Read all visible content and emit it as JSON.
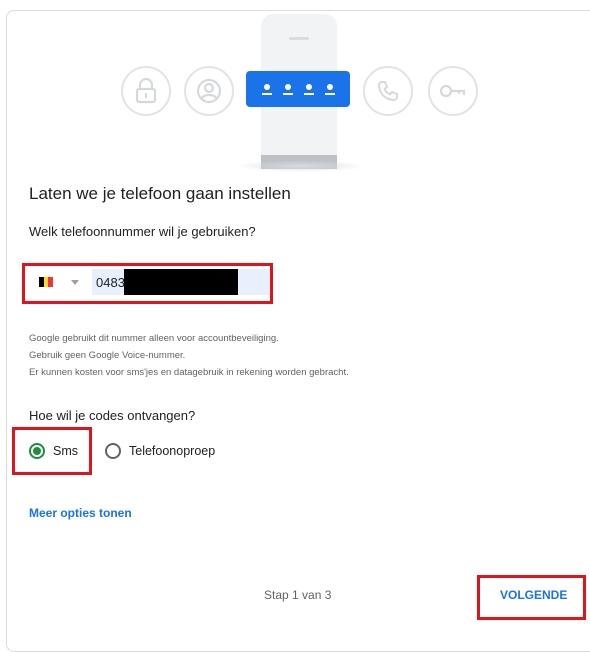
{
  "hero": {
    "icons": [
      "lock-icon",
      "account-icon",
      "pin-icon",
      "phone-icon",
      "key-icon"
    ],
    "icon_color": "#e1e3e6",
    "accent": "#1a73e8"
  },
  "title": "Laten we je telefoon gaan instellen",
  "phone_question": "Welk telefoonnummer wil je gebruiken?",
  "phone_field": {
    "country": "Belgium",
    "flag_colors": [
      "#000000",
      "#fdda24",
      "#ef3340"
    ],
    "value": "0483"
  },
  "notes": [
    "Google gebruikt dit nummer alleen voor accountbeveiliging.",
    "Gebruik geen Google Voice-nummer.",
    "Er kunnen kosten voor sms'jes en datagebruik in rekening worden gebracht."
  ],
  "codes_question": "Hoe wil je codes ontvangen?",
  "options": {
    "sms": {
      "label": "Sms",
      "selected": true
    },
    "call": {
      "label": "Telefoonoproep",
      "selected": false
    }
  },
  "more_options": "Meer opties tonen",
  "footer": {
    "step": "Stap 1 van 3",
    "next": "VOLGENDE"
  },
  "highlight_color": "#e0151b"
}
